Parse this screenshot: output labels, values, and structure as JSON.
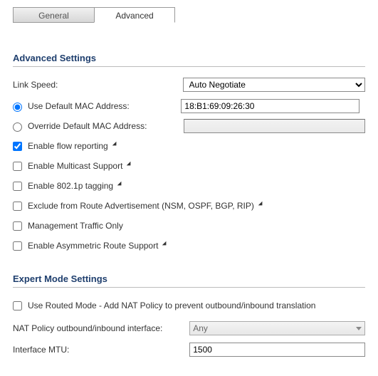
{
  "tabs": {
    "general": "General",
    "advanced": "Advanced"
  },
  "advanced": {
    "title": "Advanced Settings",
    "link_speed_label": "Link Speed:",
    "link_speed_value": "Auto Negotiate",
    "default_mac_label": "Use Default MAC Address:",
    "default_mac_value": "18:B1:69:09:26:30",
    "override_mac_label": "Override Default MAC Address:",
    "chk_flow": "Enable flow reporting",
    "chk_multicast": "Enable Multicast Support",
    "chk_8021p": "Enable 802.1p tagging",
    "chk_exclude": "Exclude from Route Advertisement (NSM, OSPF, BGP, RIP)",
    "chk_mgmt": "Management Traffic Only",
    "chk_asym": "Enable Asymmetric Route Support"
  },
  "expert": {
    "title": "Expert Mode Settings",
    "routed_label": "Use Routed Mode - Add NAT Policy to prevent outbound/inbound translation",
    "nat_label": "NAT Policy outbound/inbound interface:",
    "nat_value": "Any",
    "mtu_label": "Interface MTU:",
    "mtu_value": "1500"
  }
}
